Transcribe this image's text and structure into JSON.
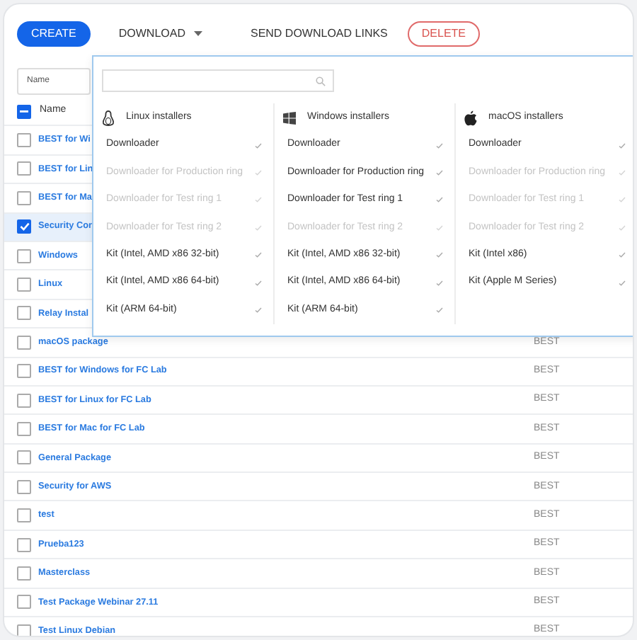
{
  "toolbar": [
    {
      "label": "CREATE",
      "kind": "primary"
    },
    {
      "label": "DOWNLOAD",
      "kind": "dropdown",
      "expanded": true
    },
    {
      "label": "SEND DOWNLOAD LINKS",
      "kind": "text"
    },
    {
      "label": "DELETE",
      "kind": "danger"
    }
  ],
  "filter": {
    "placeholder": "Name"
  },
  "table": {
    "header_checkbox": {
      "indeterminate": true
    },
    "columns": [
      "Name"
    ],
    "rows": [
      {
        "name": "BEST for Wi",
        "selected": false
      },
      {
        "name": "BEST for Lin",
        "selected": false
      },
      {
        "name": "BEST for Ma",
        "selected": false
      },
      {
        "name": "Security Cor",
        "selected": true
      },
      {
        "name": "Windows",
        "selected": false
      },
      {
        "name": "Linux",
        "selected": false
      },
      {
        "name": "Relay Instal",
        "selected": false
      },
      {
        "name": "macOS package",
        "type": "BEST",
        "selected": false
      },
      {
        "name": "BEST for Windows for FC Lab",
        "type": "BEST",
        "selected": false
      },
      {
        "name": "BEST for Linux for FC Lab",
        "type": "BEST",
        "selected": false
      },
      {
        "name": "BEST for Mac for FC Lab",
        "type": "BEST",
        "selected": false
      },
      {
        "name": "General Package",
        "type": "BEST",
        "selected": false
      },
      {
        "name": "Security for AWS",
        "type": "BEST",
        "selected": false
      },
      {
        "name": "test",
        "type": "BEST",
        "selected": false
      },
      {
        "name": "Prueba123",
        "type": "BEST",
        "selected": false
      },
      {
        "name": "Masterclass",
        "type": "BEST",
        "selected": false
      },
      {
        "name": "Test Package Webinar 27.11",
        "type": "BEST",
        "selected": false
      },
      {
        "name": "Test Linux Debian",
        "type": "BEST",
        "selected": false
      }
    ]
  },
  "download_menu": {
    "columns": [
      {
        "kind": "linux",
        "title": "Linux installers",
        "items": [
          {
            "label": "Downloader",
            "disabled": false
          },
          {
            "label": "Downloader for Production ring",
            "disabled": true
          },
          {
            "label": "Downloader for Test ring 1",
            "disabled": true
          },
          {
            "label": "Downloader for Test ring 2",
            "disabled": true
          },
          {
            "label": "Kit (Intel, AMD x86 32-bit)",
            "disabled": false
          },
          {
            "label": "Kit (Intel, AMD x86 64-bit)",
            "disabled": false
          },
          {
            "label": "Kit (ARM 64-bit)",
            "disabled": false
          }
        ]
      },
      {
        "kind": "windows",
        "title": "Windows installers",
        "items": [
          {
            "label": "Downloader",
            "disabled": false
          },
          {
            "label": "Downloader for Production ring",
            "disabled": false
          },
          {
            "label": "Downloader for Test ring 1",
            "disabled": false
          },
          {
            "label": "Downloader for Test ring 2",
            "disabled": true
          },
          {
            "label": "Kit (Intel, AMD x86 32-bit)",
            "disabled": false
          },
          {
            "label": "Kit (Intel, AMD x86 64-bit)",
            "disabled": false
          },
          {
            "label": "Kit (ARM 64-bit)",
            "disabled": false
          }
        ]
      },
      {
        "kind": "macos",
        "title": "macOS installers",
        "items": [
          {
            "label": "Downloader",
            "disabled": false
          },
          {
            "label": "Downloader for Production ring",
            "disabled": true
          },
          {
            "label": "Downloader for Test ring 1",
            "disabled": true
          },
          {
            "label": "Downloader for Test ring 2",
            "disabled": true
          },
          {
            "label": "Kit (Intel x86)",
            "disabled": false
          },
          {
            "label": "Kit (Apple M Series)",
            "disabled": false
          }
        ]
      }
    ]
  }
}
